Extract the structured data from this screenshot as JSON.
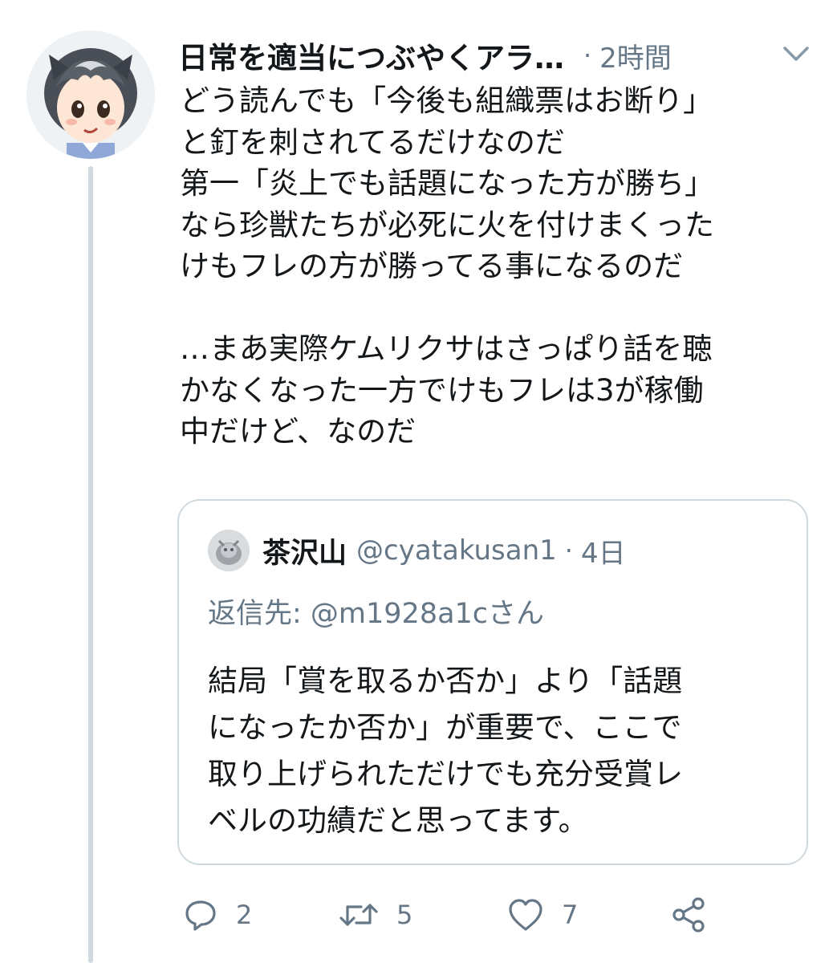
{
  "tweet": {
    "author_name": "日常を適当につぶやくアラ…",
    "separator": "·",
    "timestamp": "2時間",
    "icons": {
      "avatar": "avatar-image",
      "menu": "chevron-down-icon"
    },
    "text_lines": [
      "どう読んでも「今後も組織票はお断り」",
      "と釘を刺されてるだけなのだ",
      "第一「炎上でも話題になった方が勝ち」",
      "なら珍獣たちが必死に火を付けまくった",
      "けもフレの方が勝ってる事になるのだ",
      "",
      "…まあ実際ケムリクサはさっぱり話を聴",
      "かなくなった一方でけもフレは3が稼働",
      "中だけど、なのだ"
    ]
  },
  "quote": {
    "name": "茶沢山",
    "handle": "@cyatakusan1",
    "separator": "·",
    "timestamp": "4日",
    "reply_to": "返信先: @m1928a1cさん",
    "text_lines": [
      "結局「賞を取るか否か」より「話題",
      "になったか否か」が重要で、ここで",
      "取り上げられただけでも充分受賞レ",
      "ベルの功績だと思ってます。"
    ]
  },
  "actions": {
    "reply_count": "2",
    "retweet_count": "5",
    "like_count": "7",
    "icons": [
      "reply-icon",
      "retweet-icon",
      "like-icon",
      "share-icon"
    ]
  },
  "colors": {
    "text_primary": "#14171a",
    "text_secondary": "#657786",
    "border": "#cfd9de"
  }
}
